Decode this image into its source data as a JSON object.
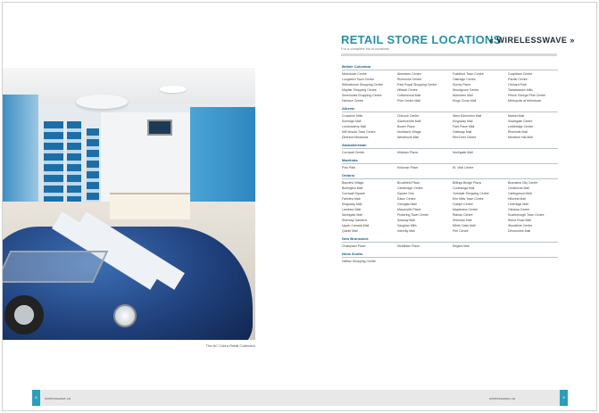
{
  "header": {
    "title": "RETAIL STORE LOCATIONS",
    "subtitle": "For a complete list of locations",
    "logo": "« WIRELESSWAVE »"
  },
  "photo": {
    "caption": "The AC Cobra Retail Collection"
  },
  "regions": [
    {
      "name": "British Columbia",
      "stores": [
        "Metrotown Centre",
        "Aberdeen Centre",
        "Guildford Town Centre",
        "Coquitlam Centre",
        "Lougheed Town Centre",
        "Richmond Centre",
        "Oakridge Centre",
        "Pacific Centre",
        "Willowbrook Shopping Centre",
        "Park Royal Shopping Centre",
        "Surrey Place",
        "Orchard Park",
        "Mayfair Shopping Centre",
        "Hillside Centre",
        "Woodgrove Centre",
        "Tsawwassen Mills",
        "Sevenoaks Shopping Centre",
        "Cottonwood Mall",
        "Aberdeen Mall",
        "Prince George Pine Centre",
        "Harbour Centre",
        "Pine Centre Mall",
        "Kings Cross Mall",
        "Metropolis at Metrotown"
      ]
    },
    {
      "name": "Alberta",
      "stores": [
        "CrossIron Mills",
        "Chinook Centre",
        "West Edmonton Mall",
        "Market Mall",
        "Sunridge Mall",
        "Southcentre Mall",
        "Kingsway Mall",
        "Southgate Centre",
        "Londonderry Mall",
        "Bower Place",
        "Park Place Mall",
        "Lethbridge Centre",
        "Mill Woods Town Centre",
        "Northland Village",
        "Gateway Mall",
        "Riverside Mall",
        "Deerfoot Meadows",
        "Westbrook Mall",
        "Red Deer Centre",
        "Medicine Hat Mall"
      ]
    },
    {
      "name": "Saskatchewan",
      "stores": [
        "Cornwall Centre",
        "Midtown Plaza",
        "Northgate Mall"
      ]
    },
    {
      "name": "Manitoba",
      "stores": [
        "Polo Park",
        "Kildonan Place",
        "St. Vital Centre"
      ]
    },
    {
      "name": "Ontario",
      "stores": [
        "Bayview Village",
        "Brookfield Place",
        "Billings Bridge Plaza",
        "Bramalea City Centre",
        "Burlington Mall",
        "Cambridge Centre",
        "Conestoga Mall",
        "Cedarbrae Mall",
        "Cornwall Square",
        "Square One",
        "Yorkdale Shopping Centre",
        "Carlingwood Mall",
        "Fairview Mall",
        "Eaton Centre",
        "Erin Mills Town Centre",
        "Hillcrest Mall",
        "Kingsway Mall",
        "Georgian Mall",
        "Guelph Centre",
        "Limeridge Mall",
        "Lambton Mall",
        "Masonville Place",
        "Mapleview Centre",
        "Oshawa Centre",
        "Northgate Mall",
        "Pickering Town Centre",
        "Rideau Centre",
        "Scarborough Town Centre",
        "Sherway Gardens",
        "Seaway Mall",
        "Sheridan Mall",
        "Stone Road Mall",
        "Upper Canada Mall",
        "Vaughan Mills",
        "White Oaks Mall",
        "Woodbine Centre",
        "Quinte Mall",
        "Intercity Mall",
        "Pen Centre",
        "Devonshire Mall"
      ]
    },
    {
      "name": "New Brunswick",
      "stores": [
        "Champlain Place",
        "McAllister Place",
        "Regent Mall"
      ]
    },
    {
      "name": "Nova Scotia",
      "stores": [
        "Halifax Shopping Centre"
      ]
    }
  ],
  "footer": {
    "left_text": "wirelesswave.ca",
    "right_text": "wirelesswave.ca",
    "page_left": "8",
    "page_right": "9"
  }
}
